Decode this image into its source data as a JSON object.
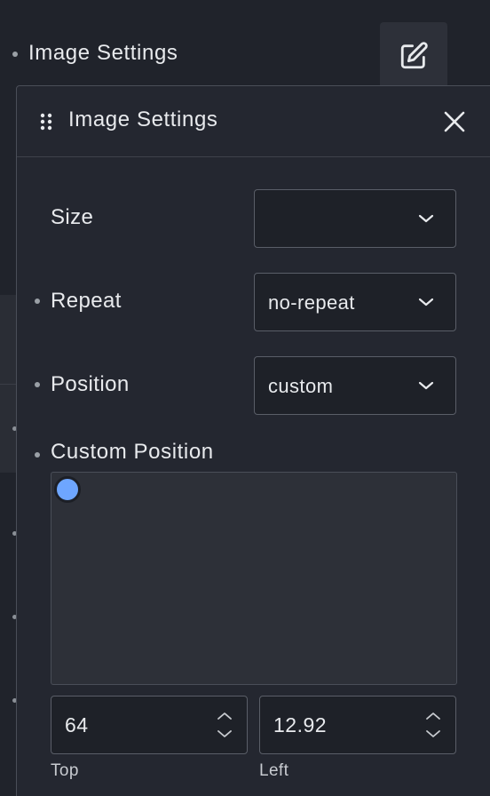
{
  "background_panel": {
    "title": "Image Settings",
    "edit_icon": "edit-icon"
  },
  "popover": {
    "title": "Image Settings",
    "drag_icon": "drag-handle-icon",
    "close_icon": "close-icon",
    "fields": {
      "size": {
        "label": "Size",
        "value": ""
      },
      "repeat": {
        "label": "Repeat",
        "value": "no-repeat"
      },
      "position": {
        "label": "Position",
        "value": "custom"
      }
    },
    "custom_position": {
      "label": "Custom Position",
      "handle_color": "#6ea6ff",
      "top": {
        "value": "64",
        "caption": "Top"
      },
      "left": {
        "value": "12.92",
        "caption": "Left"
      }
    }
  },
  "colors": {
    "background": "#20232b",
    "panel": "#242730",
    "accent": "#6ea6ff"
  }
}
